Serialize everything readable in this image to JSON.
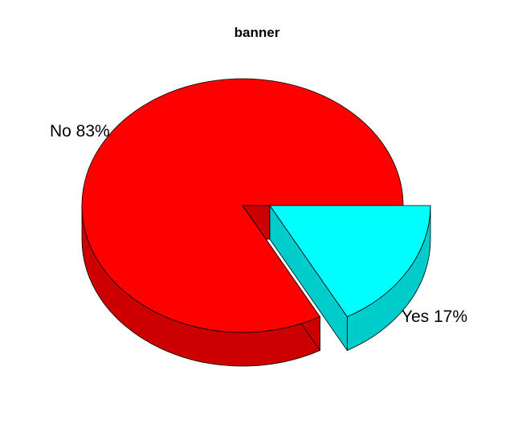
{
  "chart_data": {
    "type": "pie",
    "title": "banner",
    "three_d": true,
    "exploded": "Yes",
    "slices": [
      {
        "category": "No",
        "value": 83,
        "label": "No 83%",
        "color": "#ff0000",
        "side_color": "#cc0000"
      },
      {
        "category": "Yes",
        "value": 17,
        "label": "Yes 17%",
        "color": "#00ffff",
        "side_color": "#00cccc"
      }
    ],
    "legend": "none"
  }
}
